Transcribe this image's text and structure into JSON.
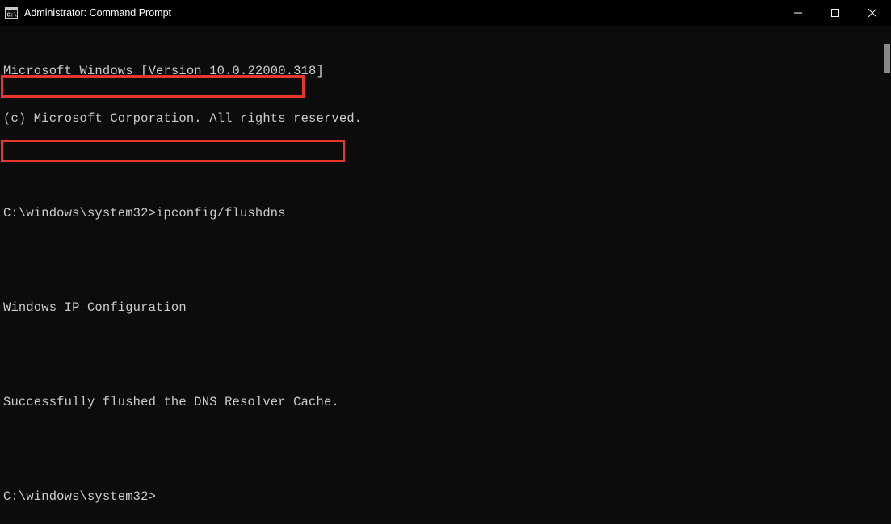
{
  "titleBar": {
    "title": "Administrator: Command Prompt"
  },
  "terminal": {
    "lines": {
      "l1": "Microsoft Windows [Version 10.0.22000.318]",
      "l2": "(c) Microsoft Corporation. All rights reserved.",
      "l3": "",
      "l4": "C:\\windows\\system32>ipconfig/flushdns",
      "l5": "",
      "l6": "Windows IP Configuration",
      "l7": "",
      "l8": "Successfully flushed the DNS Resolver Cache.",
      "l9": "",
      "l10": "C:\\windows\\system32>"
    }
  }
}
